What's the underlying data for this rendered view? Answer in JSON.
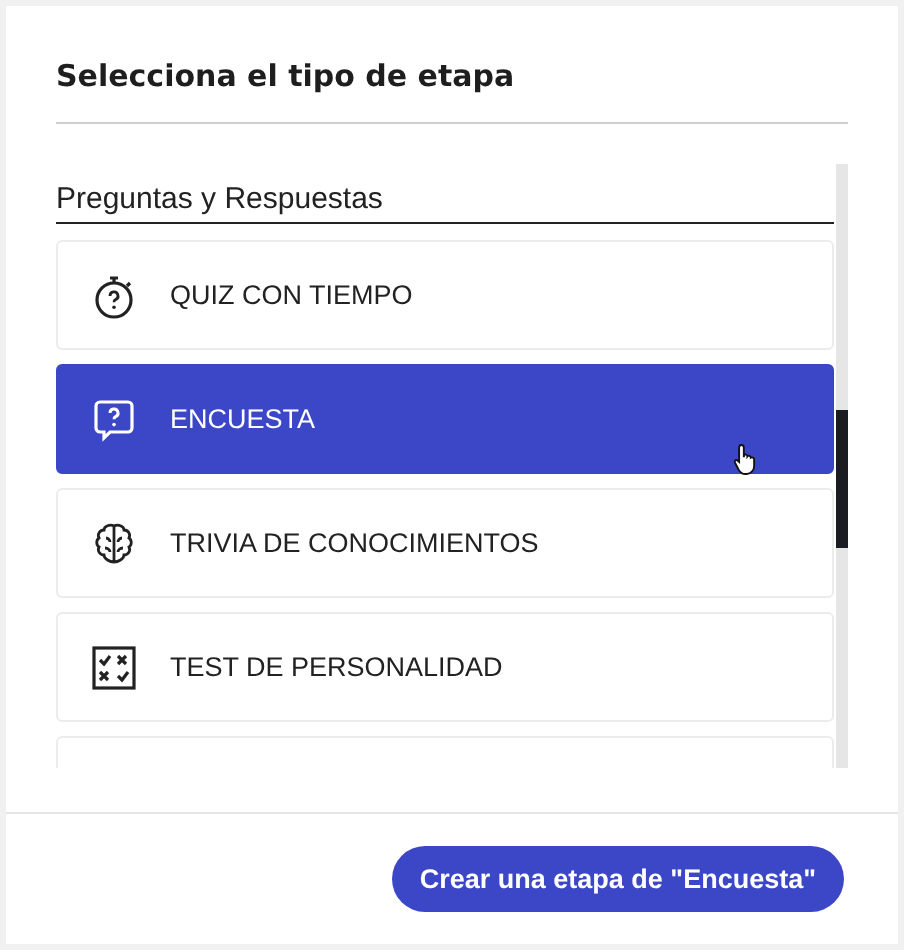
{
  "dialog": {
    "title": "Selecciona el tipo de etapa"
  },
  "section": {
    "heading": "Preguntas y Respuestas"
  },
  "options": [
    {
      "label": "QUIZ CON TIEMPO",
      "kind": "stopwatch",
      "selected": false
    },
    {
      "label": "ENCUESTA",
      "kind": "speech",
      "selected": true
    },
    {
      "label": "TRIVIA DE CONOCIMIENTOS",
      "kind": "brain",
      "selected": false
    },
    {
      "label": "TEST DE PERSONALIDAD",
      "kind": "grid",
      "selected": false
    }
  ],
  "footer": {
    "button": "Crear una etapa de \"Encuesta\""
  }
}
